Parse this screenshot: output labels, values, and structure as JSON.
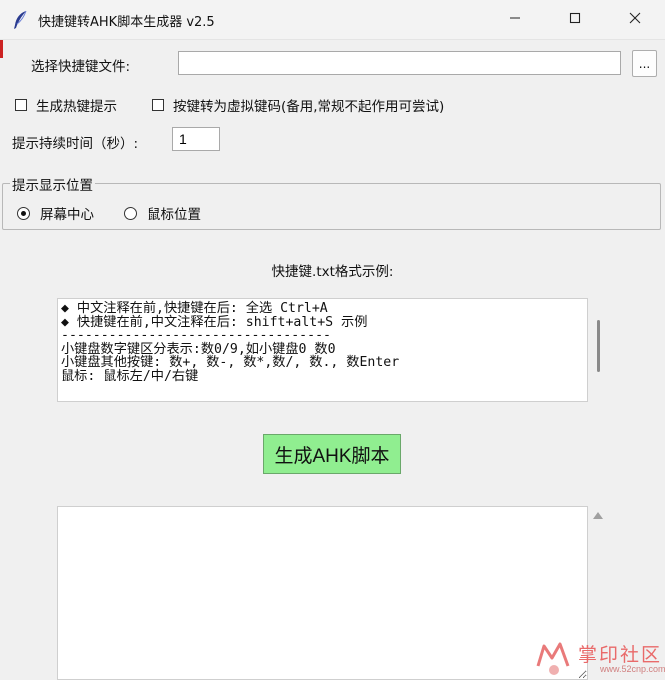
{
  "window": {
    "title": "快捷键转AHK脚本生成器 v2.5"
  },
  "file_select": {
    "label": "选择快捷键文件:",
    "value": "",
    "browse_label": "..."
  },
  "options": {
    "hotkey_tip": {
      "label": "生成热键提示",
      "checked": false
    },
    "virtual_key": {
      "label": "按键转为虚拟键码(备用,常规不起作用可尝试)",
      "checked": false
    }
  },
  "duration": {
    "label": "提示持续时间（秒）:",
    "value": "1"
  },
  "position": {
    "title": "提示显示位置",
    "options": [
      {
        "label": "屏幕中心",
        "selected": true
      },
      {
        "label": "鼠标位置",
        "selected": false
      }
    ]
  },
  "example": {
    "title": "快捷键.txt格式示例:",
    "lines": [
      "◆ 中文注释在前,快捷键在后: 全选 Ctrl+A",
      "◆ 快捷键在前,中文注释在后: shift+alt+S 示例",
      "----------------------------------",
      "小键盘数字键区分表示:数0/9,如小键盘0 数0",
      "小键盘其他按键: 数+, 数-, 数*,数/, 数., 数Enter",
      "鼠标: 鼠标左/中/右键"
    ]
  },
  "generate_button": {
    "label": "生成AHK脚本",
    "color": "#90ee90"
  },
  "output": {
    "value": ""
  },
  "watermark": {
    "text": "掌印社区",
    "url": "www.52cnp.com"
  }
}
